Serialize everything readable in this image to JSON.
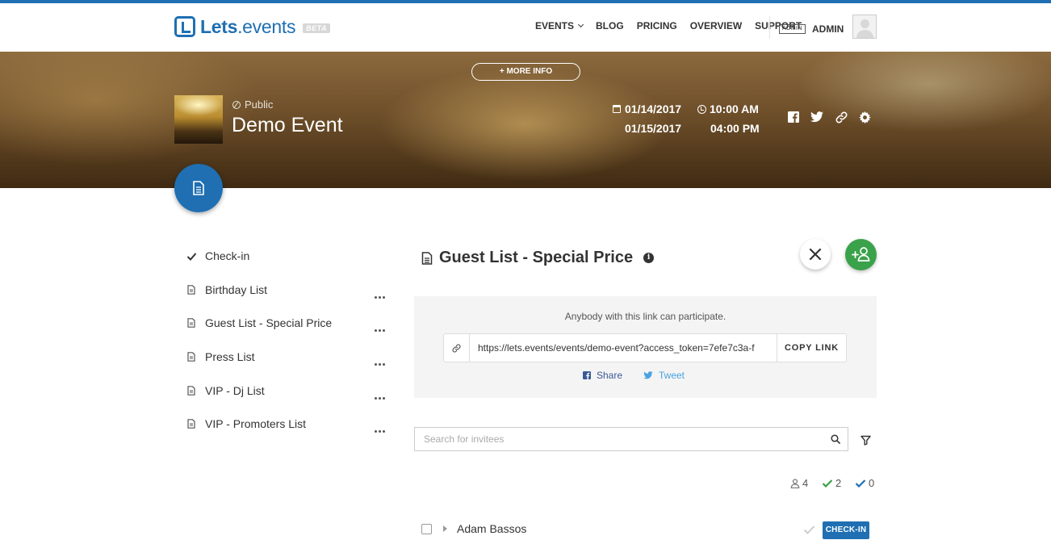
{
  "app": {
    "logo_bold": "Lets",
    "logo_light": ".events",
    "beta_label": "BETA"
  },
  "nav": {
    "items": [
      {
        "label": "EVENTS",
        "has_caret": true
      },
      {
        "label": "BLOG"
      },
      {
        "label": "PRICING"
      },
      {
        "label": "OVERVIEW"
      },
      {
        "label": "SUPPORT"
      }
    ],
    "admin_badge": "ADMIN",
    "admin_name": "ADMIN"
  },
  "event": {
    "more_info": "+ MORE INFO",
    "visibility": "Public",
    "title": "Demo Event",
    "start_date": "01/14/2017",
    "start_time": "10:00 AM",
    "end_date": "01/15/2017",
    "end_time": "04:00 PM"
  },
  "sidebar": {
    "items": [
      {
        "label": "Check-in",
        "icon": "check-icon"
      },
      {
        "label": "Birthday List",
        "icon": "document-icon"
      },
      {
        "label": "Guest List - Special Price",
        "icon": "document-icon"
      },
      {
        "label": "Press List",
        "icon": "document-icon"
      },
      {
        "label": "VIP - Dj List",
        "icon": "document-icon"
      },
      {
        "label": "VIP - Promoters List",
        "icon": "document-icon"
      }
    ]
  },
  "main": {
    "title": "Guest List - Special Price",
    "share_caption": "Anybody with this link can participate.",
    "link_url": "https://lets.events/events/demo-event?access_token=7efe7c3a-f",
    "copy_label": "COPY LINK",
    "share_label": "Share",
    "tweet_label": "Tweet",
    "search_placeholder": "Search for invitees",
    "stats": {
      "invitees": "4",
      "checked": "2",
      "confirmed": "0"
    },
    "rows": [
      {
        "name": "Adam Bassos",
        "button": "CHECK-IN"
      }
    ]
  },
  "colors": {
    "brand_blue": "#1f6fb2",
    "add_green": "#3aa24a",
    "check_green": "#3aa24a",
    "facebook_blue": "#3b5998",
    "twitter_blue": "#4aa3e0"
  }
}
